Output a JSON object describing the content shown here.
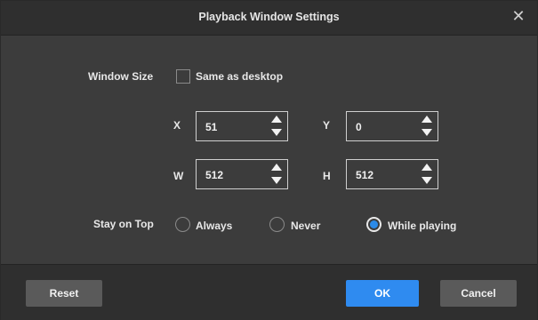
{
  "dialog": {
    "title": "Playback Window Settings",
    "close_icon": "close-icon",
    "window_size": {
      "label": "Window Size",
      "same_as_desktop_label": "Same as desktop",
      "same_as_desktop_checked": false
    },
    "coordinates": {
      "x": {
        "label": "X",
        "value": "51"
      },
      "y": {
        "label": "Y",
        "value": "0"
      },
      "w": {
        "label": "W",
        "value": "512"
      },
      "h": {
        "label": "H",
        "value": "512"
      }
    },
    "stay_on_top": {
      "label": "Stay on Top",
      "options": [
        "Always",
        "Never",
        "While playing"
      ],
      "selected": "While playing"
    },
    "buttons": {
      "reset": "Reset",
      "ok": "OK",
      "cancel": "Cancel"
    },
    "colors": {
      "accent": "#2f8bf0",
      "background": "#3c3c3c",
      "bar": "#2f2f2f"
    }
  }
}
